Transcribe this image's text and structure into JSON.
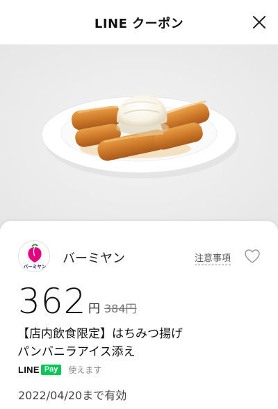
{
  "header": {
    "title": "LINE クーポン",
    "close_icon": "close-icon"
  },
  "hero": {
    "image_desc": "fried dough sticks with vanilla ice cream on white oval plate"
  },
  "store": {
    "name": "バーミヤン",
    "logo_text": "バーミヤン"
  },
  "notes_label": "注意事項",
  "price": {
    "value": "362",
    "unit": "円",
    "original": "384円"
  },
  "item": {
    "line1": "【店内飲食限定】はちみつ揚げ",
    "line2": "パンバニラアイス添え"
  },
  "payment": {
    "line": "LINE",
    "pay": "Pay",
    "usable": "使えます"
  },
  "validity": "2022/04/20まで有効",
  "colors": {
    "linepay_green": "#06c755",
    "hero_bg": "#ececec",
    "logo_pink": "#e4007f"
  }
}
